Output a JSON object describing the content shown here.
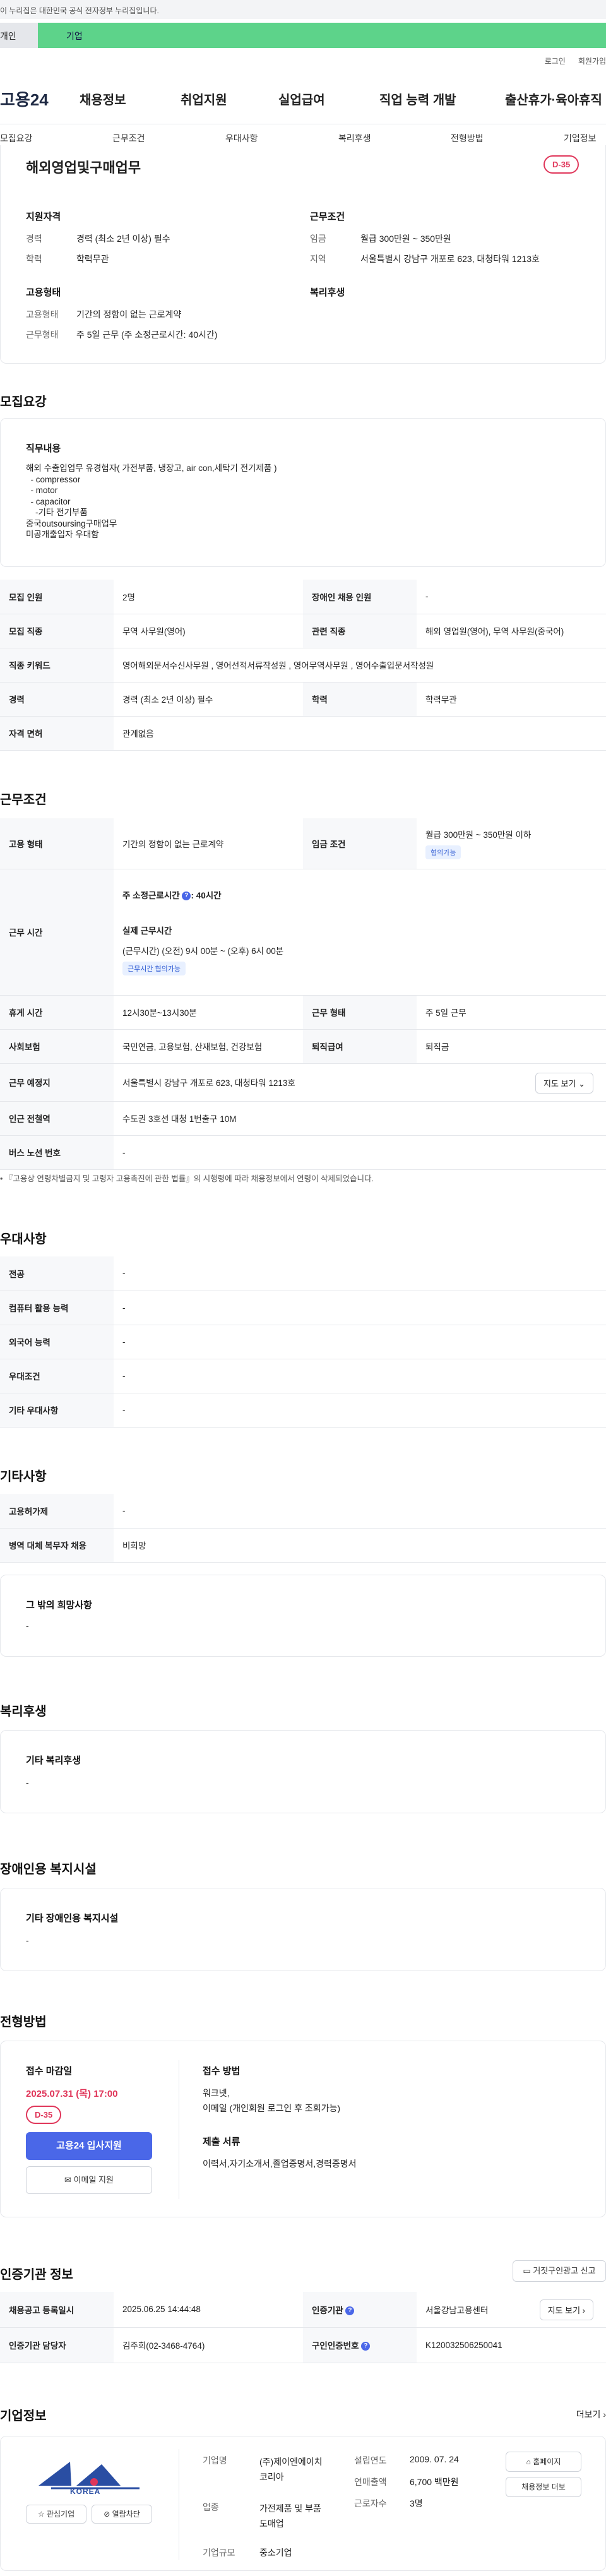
{
  "gov_banner": "이 누리집은 대한민국 공식 전자정부 누리집입니다.",
  "type_tabs": {
    "personal": "개인",
    "corporate": "기업"
  },
  "util": {
    "login": "로그인",
    "signup": "회원가입"
  },
  "logo": "고용24",
  "gnb": [
    "채용정보",
    "취업지원",
    "실업급여",
    "직업 능력 개발",
    "출산휴가·육아휴직"
  ],
  "anchor_nav": [
    "모집요강",
    "근무조건",
    "우대사항",
    "복리후생",
    "전형방법",
    "기업정보"
  ],
  "summary": {
    "title": "해외영업및구매업무",
    "dday": "D-35",
    "qual_title": "지원자격",
    "career_k": "경력",
    "career_v": "경력 (최소 2년 이상) 필수",
    "edu_k": "학력",
    "edu_v": "학력무관",
    "cond_title": "근무조건",
    "wage_k": "임금",
    "wage_v": "월급 300만원 ~ 350만원",
    "region_k": "지역",
    "region_v": "서울특별시 강남구 개포로 623, 대청타워 1213호",
    "emp_title": "고용형태",
    "type_k": "고용형태",
    "type_v": "기간의 정함이 없는 근로계약",
    "form_k": "근무형태",
    "form_v": "주 5일 근무 (주 소정근로시간: 40시간)",
    "welfare_title": "복리후생"
  },
  "recruit": {
    "heading": "모집요강",
    "duty_title": "직무내용",
    "duty_lines": [
      "해외 수출입업무 유경험자( 가전부품, 냉장고, air con,세탁기 전기제품 )",
      "  - compressor",
      "  - motor",
      "  - capacitor",
      "    -기타 전기부품",
      "중국outsoursing구매업무",
      "미공개출입자 우대함"
    ],
    "table": [
      {
        "k1": "모집 인원",
        "v1": "2명",
        "k2": "장애인 채용 인원",
        "v2": "-"
      },
      {
        "k1": "모집 직종",
        "v1": "무역 사무원(영어)",
        "k2": "관련 직종",
        "v2": "해외 영업원(영어), 무역 사무원(중국어)"
      },
      {
        "k1": "직종 키워드",
        "v1": "영어해외문서수신사무원 , 영어선적서류작성원 , 영어무역사무원 , 영어수출입문서작성원"
      },
      {
        "k1": "경력",
        "v1": "경력 (최소 2년 이상) 필수",
        "k2": "학력",
        "v2": "학력무관"
      },
      {
        "k1": "자격 면허",
        "v1": "관계없음"
      }
    ]
  },
  "workcond": {
    "heading": "근무조건",
    "emp_type_k": "고용 형태",
    "emp_type_v": "기간의 정함이 없는 근로계약",
    "wage_k": "임금 조건",
    "wage_v": "월급 300만원 ~ 350만원 이하",
    "wage_badge": "협의가능",
    "hours_k": "근무 시간",
    "hours_week": "주 소정근로시간",
    "hours_week_v": "40시간",
    "hours_actual_title": "실제 근무시간",
    "hours_actual_v": "(근무시간) (오전) 9시 00분 ~ (오후) 6시 00분",
    "hours_badge": "근무시간 협의가능",
    "rest_k": "휴게 시간",
    "rest_v": "12시30분~13시30분",
    "form_k": "근무 형태",
    "form_v": "주 5일 근무",
    "ins_k": "사회보험",
    "ins_v": "국민연금, 고용보험, 산재보험, 건강보험",
    "sev_k": "퇴직급여",
    "sev_v": "퇴직금",
    "place_k": "근무 예정지",
    "place_v": "서울특별시 강남구 개포로 623, 대청타워 1213호",
    "map_btn": "지도 보기",
    "station_k": "인근 전철역",
    "station_v": "수도권 3호선 대청 1번출구 10M",
    "bus_k": "버스 노선 번호",
    "bus_v": "-",
    "notice": "• 『고용상 연령차별금지 및 고령자 고용촉진에 관한 법률』의 시행령에 따라 채용정보에서 연령이 삭제되었습니다."
  },
  "pref": {
    "heading": "우대사항",
    "rows": [
      {
        "k": "전공",
        "v": "-"
      },
      {
        "k": "컴퓨터 활용 능력",
        "v": "-"
      },
      {
        "k": "외국어 능력",
        "v": "-"
      },
      {
        "k": "우대조건",
        "v": "-"
      },
      {
        "k": "기타 우대사항",
        "v": "-"
      }
    ]
  },
  "other": {
    "heading": "기타사항",
    "rows": [
      {
        "k": "고용허가제",
        "v": "-"
      },
      {
        "k": "병역 대체 복무자 채용",
        "v": "비희망"
      }
    ],
    "wish_title": "그 밖의 희망사항",
    "wish_v": "-"
  },
  "welfare": {
    "heading": "복리후생",
    "title": "기타 복리후생",
    "v": "-"
  },
  "disabled": {
    "heading": "장애인용 복지시설",
    "title": "기타 장애인용 복지시설",
    "v": "-"
  },
  "selection": {
    "heading": "전형방법",
    "deadline_title": "접수 마감일",
    "deadline_v": "2025.07.31 (목) 17:00",
    "dday": "D-35",
    "apply_btn": "고용24 입사지원",
    "email_btn": "이메일 지원",
    "method_title": "접수 방법",
    "method_lines": [
      "워크넷,",
      "이메일 (개인회원 로그인 후 조회가능)"
    ],
    "docs_title": "제출 서류",
    "docs_v": "이력서,자기소개서,졸업증명서,경력증명서"
  },
  "cert": {
    "heading": "인증기관 정보",
    "report_btn": "거짓구인광고 신고",
    "reg_k": "채용공고 등록일시",
    "reg_v": "2025.06.25 14:44:48",
    "org_k": "인증기관",
    "org_v": "서울강남고용센터",
    "map_btn": "지도 보기",
    "mgr_k": "인증기관 담당자",
    "mgr_v": "김주희(02-3468-4764)",
    "no_k": "구인인증번호",
    "no_v": "K120032506250041"
  },
  "company": {
    "heading": "기업정보",
    "more": "더보기",
    "logo_text": "KOREA",
    "interest_btn": "관심기업",
    "block_btn": "열람차단",
    "name_k": "기업명",
    "name_v": "(주)제이엔에이치코리아",
    "ind_k": "업종",
    "ind_v": "가전제품 및 부품 도매업",
    "size_k": "기업규모",
    "size_v": "중소기업",
    "est_k": "설립연도",
    "est_v": "2009. 07. 24",
    "sales_k": "연매출액",
    "sales_v": "6,700 백만원",
    "emp_k": "근로자수",
    "emp_v": "3명",
    "home_btn": "홈페이지",
    "list_btn": "채용정보 더보"
  }
}
